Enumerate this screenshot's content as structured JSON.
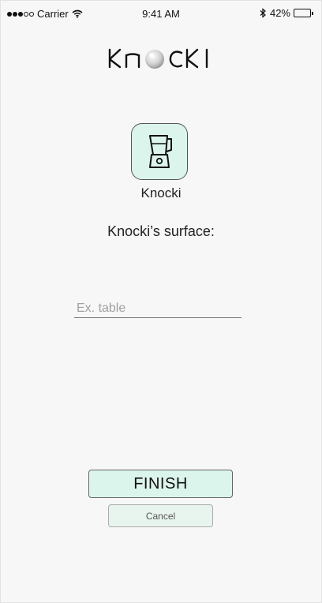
{
  "status_bar": {
    "carrier": "Carrier",
    "time": "9:41 AM",
    "battery_text": "42%",
    "battery_level": 0.42,
    "signal_bars_filled": 3,
    "signal_bars_total": 5
  },
  "header": {
    "logo_text": "KNOCKI"
  },
  "device": {
    "icon": "blender-icon",
    "name": "Knocki"
  },
  "form": {
    "prompt": "Knocki’s surface:",
    "surface_input": {
      "placeholder": "Ex. table",
      "value": ""
    }
  },
  "actions": {
    "finish_label": "FINISH",
    "cancel_label": "Cancel"
  },
  "colors": {
    "accent_mint": "#dcf5ec",
    "background": "#f7f7f7"
  }
}
